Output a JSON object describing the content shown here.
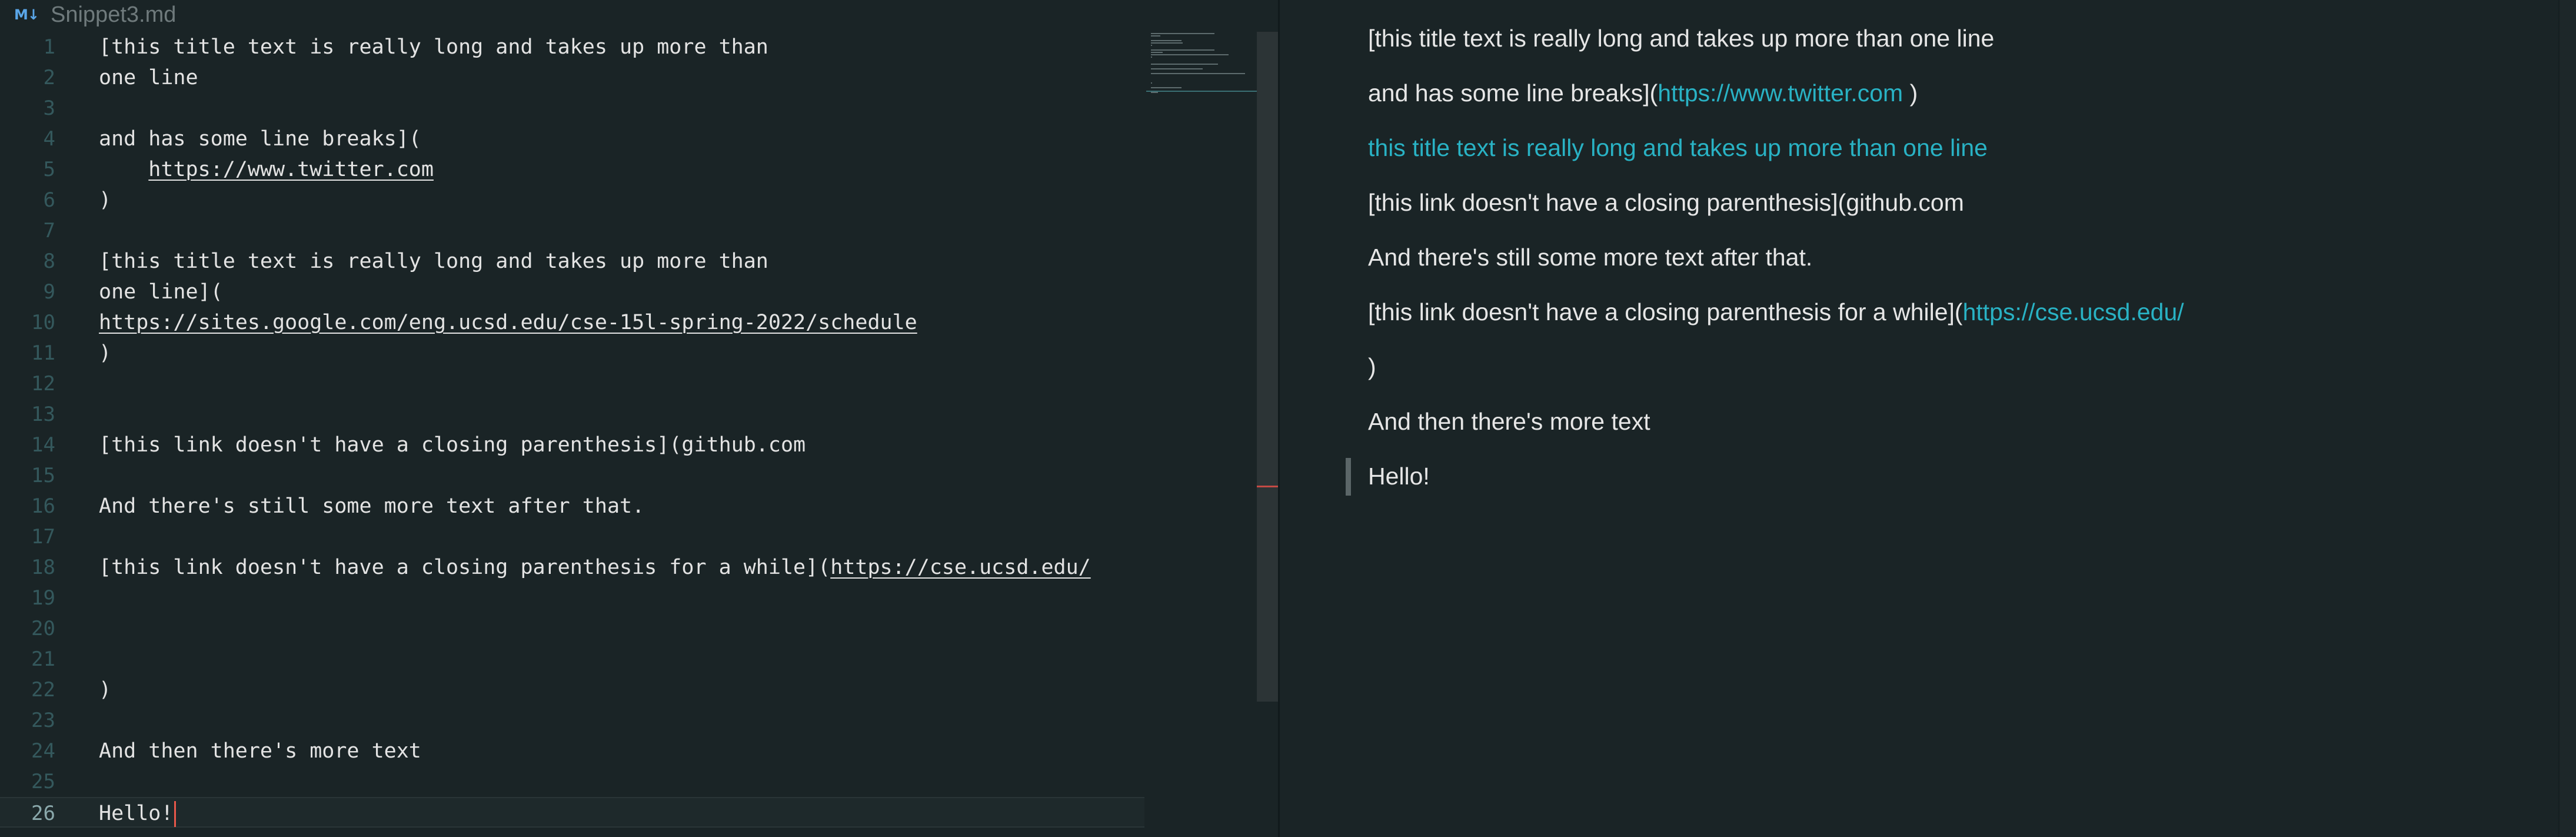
{
  "tab": {
    "icon": "M↓",
    "title": "Snippet3.md"
  },
  "editor": {
    "lines": [
      {
        "n": "1",
        "text": "[this title text is really long and takes up more than"
      },
      {
        "n": "2",
        "text": "one line"
      },
      {
        "n": "3",
        "text": ""
      },
      {
        "n": "4",
        "text": "and has some line breaks]("
      },
      {
        "n": "5",
        "indent": "    ",
        "url": "https://www.twitter.com"
      },
      {
        "n": "6",
        "text": ")"
      },
      {
        "n": "7",
        "text": ""
      },
      {
        "n": "8",
        "text": "[this title text is really long and takes up more than"
      },
      {
        "n": "9",
        "text": "one line]("
      },
      {
        "n": "10",
        "url": "https://sites.google.com/eng.ucsd.edu/cse-15l-spring-2022/schedule"
      },
      {
        "n": "11",
        "text": ")"
      },
      {
        "n": "12",
        "text": ""
      },
      {
        "n": "13",
        "text": ""
      },
      {
        "n": "14",
        "text": "[this link doesn't have a closing parenthesis](github.com"
      },
      {
        "n": "15",
        "text": ""
      },
      {
        "n": "16",
        "text": "And there's still some more text after that."
      },
      {
        "n": "17",
        "text": ""
      },
      {
        "n": "18",
        "text": "[this link doesn't have a closing parenthesis for a while](",
        "url": "https://cse.ucsd.edu/"
      },
      {
        "n": "19",
        "text": ""
      },
      {
        "n": "20",
        "text": ""
      },
      {
        "n": "21",
        "text": ""
      },
      {
        "n": "22",
        "text": ")"
      },
      {
        "n": "23",
        "text": ""
      },
      {
        "n": "24",
        "text": "And then there's more text"
      },
      {
        "n": "25",
        "text": ""
      },
      {
        "n": "26",
        "text": "Hello!",
        "current": true
      }
    ]
  },
  "preview": {
    "lines": [
      {
        "text": "[this title text is really long and takes up more than one line"
      },
      {
        "text": "and has some line breaks](",
        "link": "https://www.twitter.com",
        "after": " )"
      },
      {
        "link": "this title text is really long and takes up more than one line"
      },
      {
        "text": "[this link doesn't have a closing parenthesis](github.com"
      },
      {
        "text": "And there's still some more text after that."
      },
      {
        "text": "[this link doesn't have a closing parenthesis for a while](",
        "link": "https://cse.ucsd.edu/"
      },
      {
        "text": ")"
      },
      {
        "text": "And then there's more text"
      },
      {
        "text": "Hello!",
        "quote": true
      }
    ]
  },
  "colors": {
    "background": "#1a2426",
    "link": "#29b2c4",
    "caret": "#e8584a",
    "line_number": "#34585c"
  }
}
